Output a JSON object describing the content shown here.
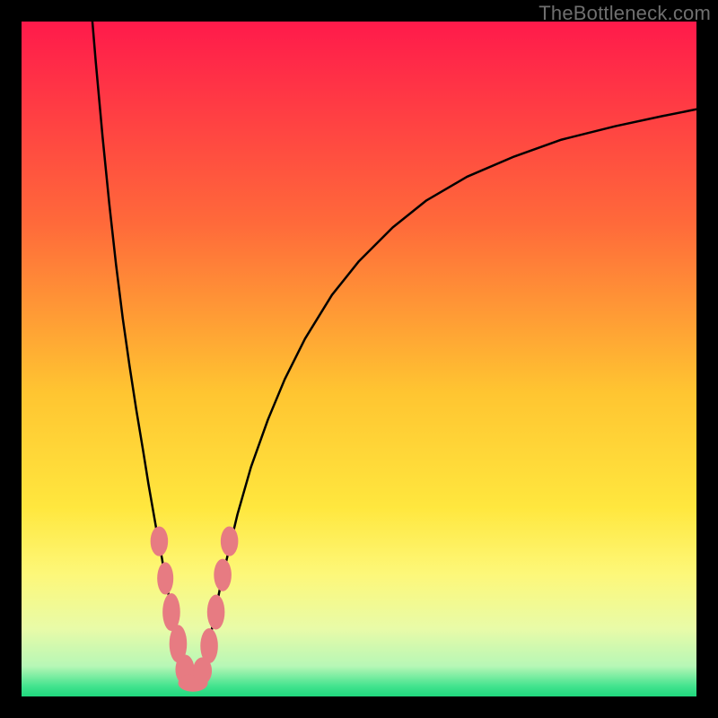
{
  "watermark": "TheBottleneck.com",
  "chart_data": {
    "type": "line",
    "title": "",
    "xlabel": "",
    "ylabel": "",
    "xlim": [
      0,
      100
    ],
    "ylim": [
      0,
      100
    ],
    "grid": false,
    "legend": false,
    "gradient_stops": [
      {
        "offset": 0.0,
        "color": "#ff1a4b"
      },
      {
        "offset": 0.3,
        "color": "#ff6a3a"
      },
      {
        "offset": 0.55,
        "color": "#ffc531"
      },
      {
        "offset": 0.72,
        "color": "#ffe73e"
      },
      {
        "offset": 0.82,
        "color": "#fdf87a"
      },
      {
        "offset": 0.9,
        "color": "#e8fba8"
      },
      {
        "offset": 0.955,
        "color": "#b7f7b6"
      },
      {
        "offset": 0.985,
        "color": "#42e38e"
      },
      {
        "offset": 1.0,
        "color": "#1fd87d"
      }
    ],
    "series": [
      {
        "name": "left-branch",
        "x": [
          10.5,
          11.0,
          12.0,
          13.0,
          14.0,
          15.0,
          16.0,
          17.0,
          18.0,
          18.8,
          19.5,
          20.2,
          20.8,
          21.2,
          21.6,
          22.0,
          22.4,
          22.8,
          23.2,
          23.6,
          24.0,
          24.5,
          25.0,
          25.5
        ],
        "y": [
          100,
          94.0,
          83.0,
          73.0,
          64.0,
          56.0,
          49.0,
          42.5,
          36.5,
          31.5,
          27.5,
          23.5,
          20.5,
          18.0,
          16.0,
          14.0,
          12.0,
          10.0,
          8.0,
          6.0,
          4.5,
          3.0,
          2.0,
          1.5
        ]
      },
      {
        "name": "right-branch",
        "x": [
          25.5,
          26.0,
          26.5,
          27.0,
          27.8,
          28.6,
          29.6,
          30.8,
          32.0,
          34.0,
          36.5,
          39.0,
          42.0,
          46.0,
          50.0,
          55.0,
          60.0,
          66.0,
          73.0,
          80.0,
          88.0,
          95.0,
          100.0
        ],
        "y": [
          1.5,
          2.0,
          3.0,
          5.0,
          8.0,
          12.0,
          17.0,
          22.0,
          27.0,
          34.0,
          41.0,
          47.0,
          53.0,
          59.5,
          64.5,
          69.5,
          73.5,
          77.0,
          80.0,
          82.5,
          84.5,
          86.0,
          87.0
        ]
      }
    ],
    "markers": {
      "name": "highlight-beads",
      "color": "#e77b82",
      "points": [
        {
          "x": 20.4,
          "y": 23.0,
          "rx": 1.3,
          "ry": 2.2
        },
        {
          "x": 21.3,
          "y": 17.5,
          "rx": 1.2,
          "ry": 2.4
        },
        {
          "x": 22.2,
          "y": 12.5,
          "rx": 1.3,
          "ry": 2.8
        },
        {
          "x": 23.2,
          "y": 7.8,
          "rx": 1.3,
          "ry": 2.8
        },
        {
          "x": 24.2,
          "y": 4.0,
          "rx": 1.4,
          "ry": 2.2
        },
        {
          "x": 25.4,
          "y": 2.0,
          "rx": 2.2,
          "ry": 1.3
        },
        {
          "x": 26.8,
          "y": 3.8,
          "rx": 1.4,
          "ry": 2.0
        },
        {
          "x": 27.8,
          "y": 7.5,
          "rx": 1.3,
          "ry": 2.6
        },
        {
          "x": 28.8,
          "y": 12.5,
          "rx": 1.3,
          "ry": 2.6
        },
        {
          "x": 29.8,
          "y": 18.0,
          "rx": 1.3,
          "ry": 2.4
        },
        {
          "x": 30.8,
          "y": 23.0,
          "rx": 1.3,
          "ry": 2.2
        }
      ]
    }
  }
}
